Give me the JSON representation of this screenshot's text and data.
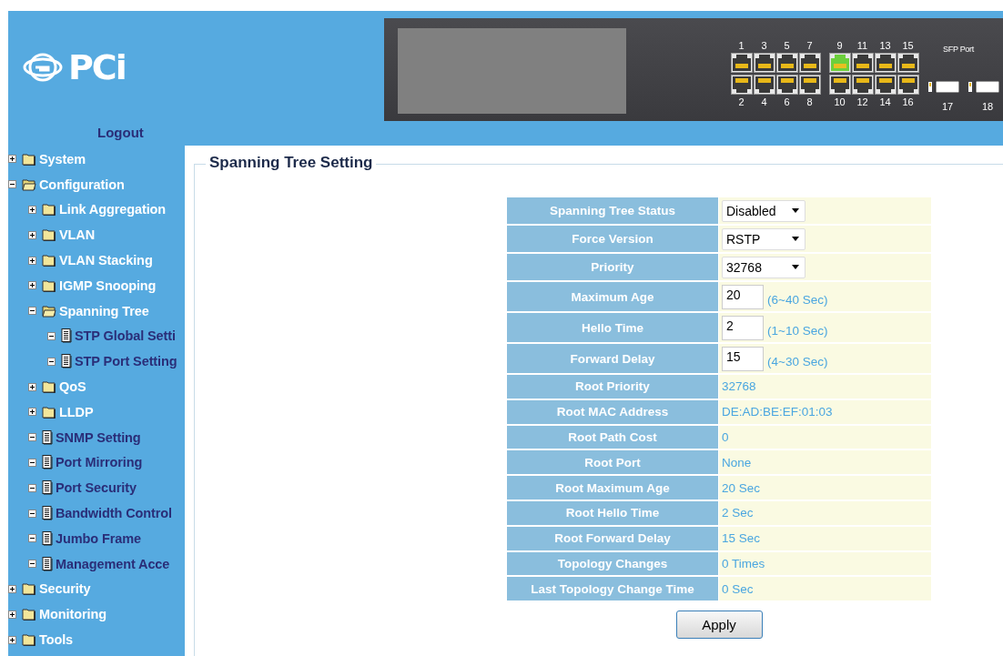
{
  "header": {
    "logo": "PCi",
    "logout": "Logout"
  },
  "switch": {
    "ports": [
      {
        "number": "1",
        "linked": false
      },
      {
        "number": "2",
        "linked": false
      },
      {
        "number": "3",
        "linked": false
      },
      {
        "number": "4",
        "linked": false
      },
      {
        "number": "5",
        "linked": false
      },
      {
        "number": "6",
        "linked": false
      },
      {
        "number": "7",
        "linked": false
      },
      {
        "number": "8",
        "linked": false
      },
      {
        "number": "9",
        "linked": true
      },
      {
        "number": "10",
        "linked": false
      },
      {
        "number": "11",
        "linked": false
      },
      {
        "number": "12",
        "linked": false
      },
      {
        "number": "13",
        "linked": false
      },
      {
        "number": "14",
        "linked": false
      },
      {
        "number": "15",
        "linked": false
      },
      {
        "number": "16",
        "linked": false
      }
    ],
    "sfp_label": "SFP Port",
    "sfp_ports": [
      "17",
      "18"
    ]
  },
  "sidebar": {
    "items": [
      {
        "kind": "folder",
        "label": "System",
        "expanded": false
      },
      {
        "kind": "folder",
        "label": "Configuration",
        "expanded": true,
        "children": [
          {
            "kind": "folder",
            "label": "Link Aggregation",
            "expanded": false
          },
          {
            "kind": "folder",
            "label": "VLAN",
            "expanded": false
          },
          {
            "kind": "folder",
            "label": "VLAN Stacking",
            "expanded": false
          },
          {
            "kind": "folder",
            "label": "IGMP Snooping",
            "expanded": false
          },
          {
            "kind": "folder",
            "label": "Spanning Tree",
            "expanded": true,
            "children": [
              {
                "kind": "page",
                "label": "STP Global Setti"
              },
              {
                "kind": "page",
                "label": "STP Port Setting"
              }
            ]
          },
          {
            "kind": "folder",
            "label": "QoS",
            "expanded": false
          },
          {
            "kind": "folder",
            "label": "LLDP",
            "expanded": false
          },
          {
            "kind": "page",
            "label": "SNMP Setting"
          },
          {
            "kind": "page",
            "label": "Port Mirroring"
          },
          {
            "kind": "page",
            "label": "Port Security"
          },
          {
            "kind": "page",
            "label": "Bandwidth Control"
          },
          {
            "kind": "page",
            "label": "Jumbo Frame"
          },
          {
            "kind": "page",
            "label": "Management Acce"
          }
        ]
      },
      {
        "kind": "folder",
        "label": "Security",
        "expanded": false
      },
      {
        "kind": "folder",
        "label": "Monitoring",
        "expanded": false
      },
      {
        "kind": "folder",
        "label": "Tools",
        "expanded": false
      }
    ]
  },
  "settings": {
    "title": "Spanning Tree Setting",
    "rows": [
      {
        "kind": "select",
        "label": "Spanning Tree Status",
        "value": "Disabled"
      },
      {
        "kind": "select",
        "label": "Force Version",
        "value": "RSTP"
      },
      {
        "kind": "select",
        "label": "Priority",
        "value": "32768"
      },
      {
        "kind": "input",
        "label": "Maximum Age",
        "value": "20",
        "hint": "(6~40 Sec)"
      },
      {
        "kind": "input",
        "label": "Hello Time",
        "value": "2",
        "hint": "(1~10 Sec)"
      },
      {
        "kind": "input",
        "label": "Forward Delay",
        "value": "15",
        "hint": "(4~30 Sec)"
      },
      {
        "kind": "text",
        "label": "Root Priority",
        "value": "32768"
      },
      {
        "kind": "text",
        "label": "Root MAC Address",
        "value": "DE:AD:BE:EF:01:03"
      },
      {
        "kind": "text",
        "label": "Root Path Cost",
        "value": "0"
      },
      {
        "kind": "text",
        "label": "Root Port",
        "value": "None"
      },
      {
        "kind": "text",
        "label": "Root Maximum Age",
        "value": "20 Sec"
      },
      {
        "kind": "text",
        "label": "Root Hello Time",
        "value": "2 Sec"
      },
      {
        "kind": "text",
        "label": "Root Forward Delay",
        "value": "15 Sec"
      },
      {
        "kind": "text",
        "label": "Topology Changes",
        "value": "0 Times"
      },
      {
        "kind": "text",
        "label": "Last Topology Change Time",
        "value": "0 Sec"
      }
    ],
    "apply": "Apply"
  }
}
